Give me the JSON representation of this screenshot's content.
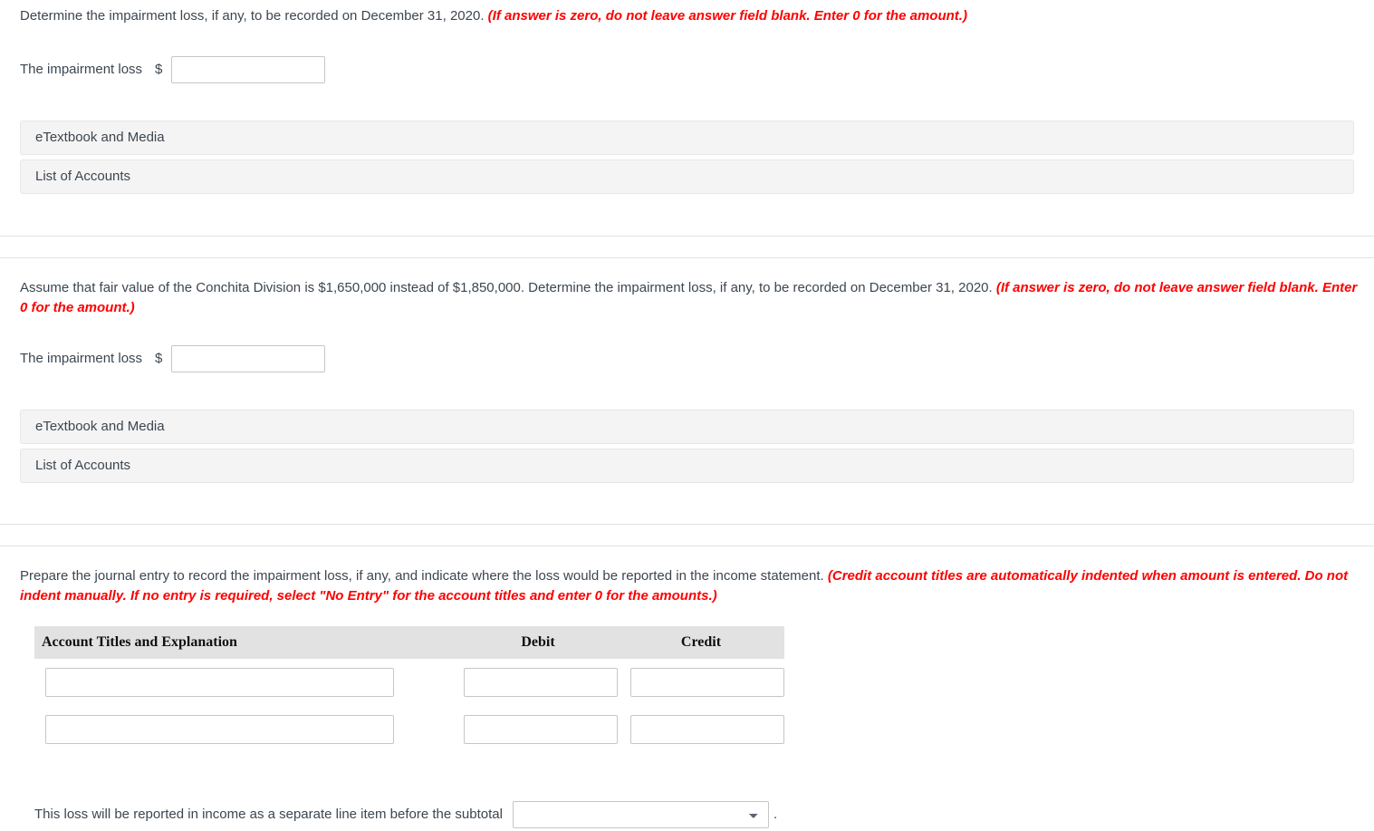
{
  "sections": [
    {
      "id": "part-a",
      "prompt_main": "Determine the impairment loss, if any, to be recorded on December 31, 2020.",
      "prompt_hint": "(If answer is zero, do not leave answer field blank. Enter 0 for the amount.)",
      "answer_label": "The impairment loss",
      "currency_symbol": "$",
      "answer_value": "",
      "answer_placeholder": "",
      "etextbook_label": "eTextbook and Media",
      "list_accounts_label": "List of Accounts"
    },
    {
      "id": "part-b",
      "prompt_main": "Assume that fair value of the Conchita Division is $1,650,000 instead of $1,850,000. Determine the impairment loss, if any, to be recorded on December 31, 2020.",
      "prompt_hint": "(If answer is zero, do not leave answer field blank. Enter 0 for the amount.)",
      "answer_label": "The impairment loss",
      "currency_symbol": "$",
      "answer_value": "",
      "answer_placeholder": "",
      "etextbook_label": "eTextbook and Media",
      "list_accounts_label": "List of Accounts"
    }
  ],
  "journal": {
    "prompt_main": "Prepare the journal entry to record the impairment loss, if any, and indicate where the loss would be reported in the income statement.",
    "prompt_hint": "(Credit account titles are automatically indented when amount is entered. Do not indent manually. If no entry is required, select \"No Entry\" for the account titles and enter 0 for the amounts.)",
    "columns": [
      "Account Titles and Explanation",
      "Debit",
      "Credit"
    ],
    "rows": [
      {
        "account": "",
        "debit": "",
        "credit": ""
      },
      {
        "account": "",
        "debit": "",
        "credit": ""
      }
    ],
    "footer_text": "This loss will be reported in income as a separate line item before the subtotal",
    "footer_select_value": "",
    "footer_select_options": [
      ""
    ],
    "footer_period": "."
  },
  "colors": {
    "hint_red": "#ff0000",
    "body_text": "#3c4650",
    "bar_background": "#f4f4f4",
    "table_header_background": "#e2e2e2",
    "input_border": "#c6c6c6",
    "divider": "#e2e2e2"
  }
}
